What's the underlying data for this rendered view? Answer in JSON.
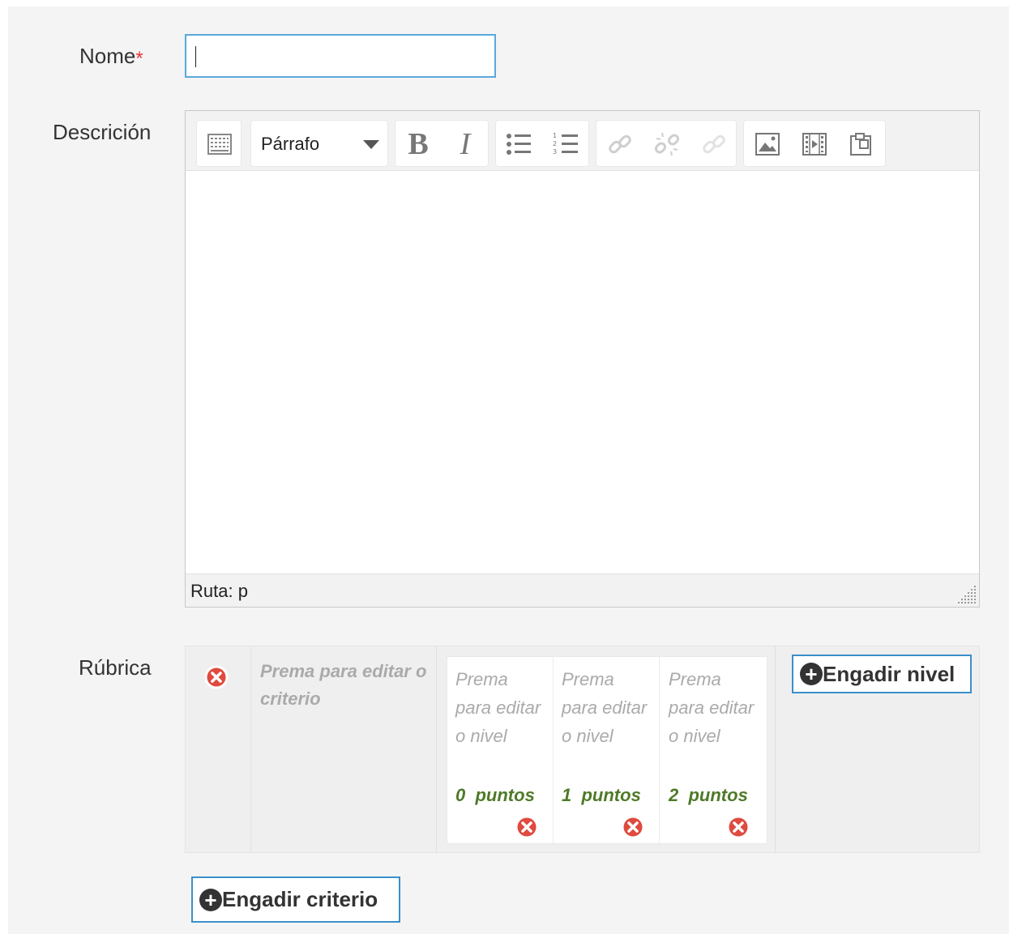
{
  "form": {
    "name_label": "Nome",
    "required_mark": "*",
    "name_value": "",
    "description_label": "Descrición",
    "rubric_label": "Rúbrica"
  },
  "editor": {
    "toolbar": {
      "format_select": "Párrafo",
      "buttons": [
        "toggle-toolbar-icon",
        "bold-icon",
        "italic-icon",
        "unordered-list-icon",
        "ordered-list-icon",
        "link-icon",
        "unlink-icon",
        "anchor-icon",
        "image-icon",
        "media-icon",
        "paste-icon"
      ],
      "bold_glyph": "B",
      "italic_glyph": "I"
    },
    "status_path": "Ruta: p"
  },
  "rubric": {
    "criterion_placeholder": "Prema para editar o criterio",
    "levels": [
      {
        "text": "Prema para editar o nivel",
        "score_value": "0",
        "score_unit": "puntos"
      },
      {
        "text": "Prema para editar o nivel",
        "score_value": "1",
        "score_unit": "puntos"
      },
      {
        "text": "Prema para editar o nivel",
        "score_value": "2",
        "score_unit": "puntos"
      }
    ],
    "add_level_label": "Engadir nivel",
    "add_criterion_label": "Engadir criterio"
  },
  "colors": {
    "required": "#e4373d",
    "input_border": "#5aa8dd",
    "score": "#4f7a28",
    "delete": "#e04a3f"
  }
}
